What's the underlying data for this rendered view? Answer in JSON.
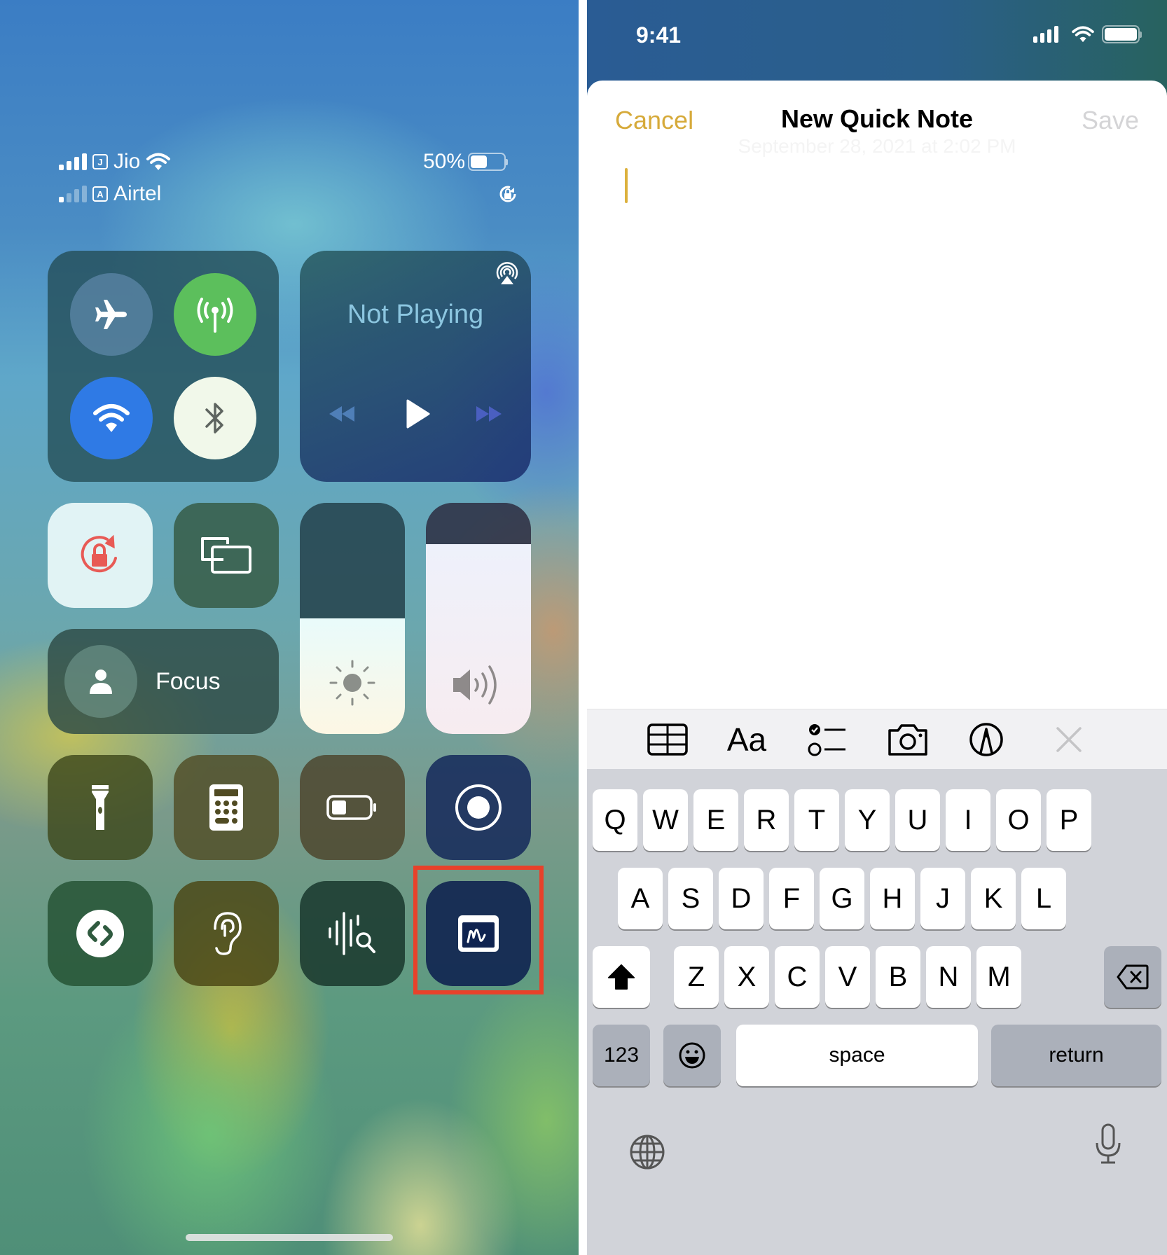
{
  "control_center": {
    "carriers": [
      {
        "name": "Jio",
        "sim_badge": "J",
        "signal_bars": 4,
        "signal_strength": 4,
        "wifi": true
      },
      {
        "name": "Airtel",
        "sim_badge": "A",
        "signal_bars": 4,
        "signal_strength": 1,
        "wifi": false
      }
    ],
    "battery": {
      "label": "50%",
      "level": 0.5
    },
    "rotation_lock_status_icon": "rotation-lock-icon",
    "connectivity": {
      "airplane_mode": {
        "icon": "airplane-icon",
        "on": false
      },
      "cellular_data": {
        "icon": "antenna-icon",
        "on": true,
        "color": "#5cbf5c"
      },
      "wifi": {
        "icon": "wifi-icon",
        "on": true,
        "color": "#2f7ae5"
      },
      "bluetooth": {
        "icon": "bluetooth-icon",
        "on": true
      }
    },
    "now_playing": {
      "title": "Not Playing",
      "airplay_icon": "airplay-icon",
      "controls": [
        "rewind",
        "play",
        "fast-forward"
      ]
    },
    "rotation_lock": {
      "icon": "rotation-lock-icon",
      "on": true,
      "color": "#e85a55"
    },
    "screen_mirroring": {
      "icon": "screen-mirroring-icon"
    },
    "focus": {
      "label": "Focus",
      "icon": "person-icon"
    },
    "brightness": {
      "icon": "sun-icon",
      "level": 0.5
    },
    "volume": {
      "icon": "speaker-icon",
      "level": 0.82
    },
    "tiles_row4": [
      {
        "name": "flashlight",
        "icon": "flashlight-icon"
      },
      {
        "name": "calculator",
        "icon": "calculator-icon"
      },
      {
        "name": "low-power-mode",
        "icon": "battery-icon"
      },
      {
        "name": "screen-recording",
        "icon": "record-icon"
      }
    ],
    "tiles_row5": [
      {
        "name": "shazam",
        "icon": "shazam-icon"
      },
      {
        "name": "hearing",
        "icon": "ear-icon"
      },
      {
        "name": "sound-recognition",
        "icon": "sound-recognition-icon"
      },
      {
        "name": "quick-note",
        "icon": "quick-note-icon",
        "highlighted": true
      }
    ],
    "highlight_color": "#e8412a"
  },
  "quick_note": {
    "status_bar": {
      "time": "9:41"
    },
    "header": {
      "cancel": "Cancel",
      "title": "New Quick Note",
      "save": "Save",
      "date": "September 28, 2021 at 2:02 PM"
    },
    "accent_color": "#d6aa3a",
    "body_text": "",
    "toolbar": [
      {
        "name": "table",
        "icon": "table-icon"
      },
      {
        "name": "format",
        "label": "Aa",
        "icon": "text-format-icon"
      },
      {
        "name": "checklist",
        "icon": "checklist-icon"
      },
      {
        "name": "camera",
        "icon": "camera-icon"
      },
      {
        "name": "markup",
        "icon": "markup-pen-icon"
      },
      {
        "name": "close",
        "icon": "close-icon"
      }
    ],
    "keyboard": {
      "row1": [
        "Q",
        "W",
        "E",
        "R",
        "T",
        "Y",
        "U",
        "I",
        "O",
        "P"
      ],
      "row2": [
        "A",
        "S",
        "D",
        "F",
        "G",
        "H",
        "J",
        "K",
        "L"
      ],
      "row3": [
        "Z",
        "X",
        "C",
        "V",
        "B",
        "N",
        "M"
      ],
      "numbers": "123",
      "space": "space",
      "return": "return"
    }
  }
}
